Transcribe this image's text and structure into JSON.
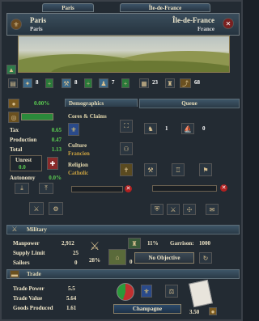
{
  "header": {
    "tab_left": "Paris",
    "tab_right": "Île-de-France",
    "province_name": "Paris",
    "province_sub": "Paris",
    "region_name": "Île-de-France",
    "region_sub": "France"
  },
  "stats": {
    "tax_dev": "8",
    "prod_dev": "8",
    "manpower_dev": "7",
    "buildings": "23",
    "value2": "68"
  },
  "economy": {
    "percent": "0.00%",
    "tax_label": "Tax",
    "tax_value": "0.65",
    "production_label": "Production",
    "production_value": "0.47",
    "total_label": "Total",
    "total_value": "1.13",
    "unrest_label": "Unrest",
    "unrest_value": "0.0",
    "autonomy_label": "Autonomy",
    "autonomy_value": "0.0%"
  },
  "demographics": {
    "title": "Demographics",
    "cores_label": "Cores & Claims",
    "culture_label": "Culture",
    "culture_value": "Francien",
    "religion_label": "Religion",
    "religion_value": "Catholic"
  },
  "queue": {
    "title": "Queue",
    "count1": "1",
    "count2": "0"
  },
  "military": {
    "title": "Military",
    "manpower_label": "Manpower",
    "manpower_value": "2,912",
    "supply_label": "Supply Limit",
    "supply_value": "25",
    "sailors_label": "Sailors",
    "sailors_value": "0",
    "fort_percent": "28%",
    "garrison_pct": "11%",
    "garrison_label": "Garrison:",
    "garrison_value": "1000",
    "objective": "No Objective",
    "unit_count": "0"
  },
  "trade": {
    "title": "Trade",
    "power_label": "Trade Power",
    "power_value": "5.5",
    "value_label": "Trade Value",
    "value_value": "5.64",
    "goods_label": "Goods Produced",
    "goods_value": "1.61",
    "goods_name": "Champagne",
    "price": "3.50"
  },
  "colors": {
    "green": "#5ccf52",
    "tan": "#e8dcb0",
    "panel": "#232b33"
  }
}
